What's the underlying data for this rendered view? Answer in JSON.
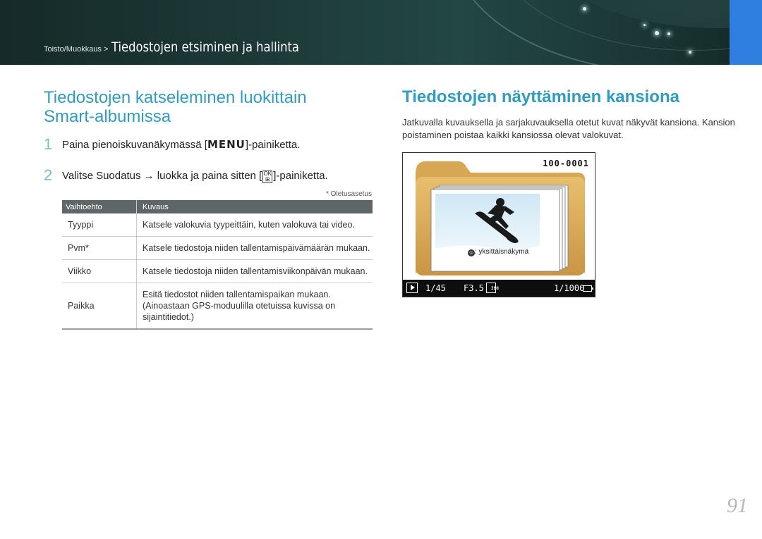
{
  "header": {
    "breadcrumb_section": "Toisto/Muokkaus >",
    "breadcrumb_title": "Tiedostojen etsiminen ja hallinta"
  },
  "left": {
    "heading": "Tiedostojen katseleminen luokittain Smart-albumissa",
    "step1": {
      "number": "1",
      "text_before": "Paina pienoiskuvanäkymässä [",
      "key": "MENU",
      "text_after": "]-painiketta."
    },
    "step2": {
      "number": "2",
      "text_before": "Valitse ",
      "bold": "Suodatus",
      "text_middle": " → luokka ja paina sitten [",
      "key_top": "OK",
      "text_after": "]-painiketta."
    },
    "note": "* Oletusasetus",
    "table": {
      "headers": [
        "Vaihtoehto",
        "Kuvaus"
      ],
      "rows": [
        {
          "option": "Tyyppi",
          "desc": "Katsele valokuvia tyypeittäin, kuten valokuva tai video."
        },
        {
          "option": "Pvm*",
          "desc": "Katsele tiedostoja niiden tallentamispäivämäärän mukaan."
        },
        {
          "option": "Viikko",
          "desc": "Katsele tiedostoja niiden tallentamisviikonpäivän mukaan."
        },
        {
          "option": "Paikka",
          "desc": "Esitä tiedostot niiden tallentamispaikan mukaan. (Ainoastaan GPS-moduulilla otetuissa kuvissa on sijaintitiedot.)"
        }
      ]
    }
  },
  "right": {
    "heading": "Tiedostojen näyttäminen kansiona",
    "paragraph": "Jatkuvalla kuvauksella ja sarjakuvauksella otetut kuvat näkyvät kansiona. Kansion poistaminen poistaa kaikki kansiossa olevat valokuvat.",
    "camera": {
      "folder_code": "100-0001",
      "single_view_label": ": yksittäisnäkymä",
      "frame_count": "1/45",
      "aperture": "F3.5",
      "iso_top": "ISO",
      "iso_value": "200",
      "shutter": "1/1000"
    }
  },
  "page_number": "91",
  "colors": {
    "heading_blue": "#2e9dc0",
    "header_teal": "#1d3a38",
    "accent_blue_tab": "#2f7fe0",
    "table_header_gray": "#5e6667",
    "folder_tan": "#d9a657"
  }
}
